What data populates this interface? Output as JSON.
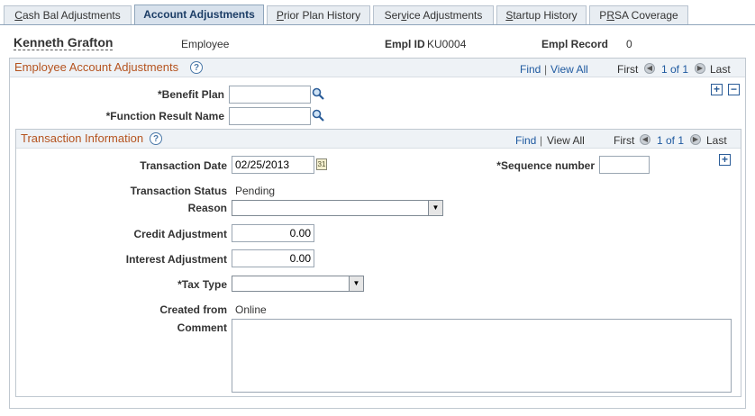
{
  "tabs": [
    {
      "prefix": "",
      "u": "C",
      "rest": "ash Bal Adjustments"
    },
    {
      "prefix": "",
      "u": "",
      "rest": "Account Adjustments"
    },
    {
      "prefix": "",
      "u": "P",
      "rest": "rior Plan History"
    },
    {
      "prefix": "Ser",
      "u": "v",
      "rest": "ice Adjustments"
    },
    {
      "prefix": "",
      "u": "S",
      "rest": "tartup History"
    },
    {
      "prefix": "P",
      "u": "R",
      "rest": "SA Coverage"
    }
  ],
  "header": {
    "name": "Kenneth Grafton",
    "role": "Employee",
    "empl_id_label": "Empl ID",
    "empl_id": "KU0004",
    "empl_record_label": "Empl Record",
    "empl_record": "0"
  },
  "account_box": {
    "title": "Employee Account Adjustments",
    "find": "Find",
    "view_all": "View All",
    "first": "First",
    "count": "1 of 1",
    "last": "Last",
    "benefit_plan_label": "*Benefit Plan",
    "benefit_plan_value": "",
    "function_result_label": "*Function Result Name",
    "function_result_value": ""
  },
  "transaction_box": {
    "title": "Transaction Information",
    "find": "Find",
    "view_all": "View All",
    "first": "First",
    "count": "1 of 1",
    "last": "Last",
    "date_label": "Transaction Date",
    "date_value": "02/25/2013",
    "sequence_label": "*Sequence number",
    "sequence_value": "",
    "status_label": "Transaction Status",
    "status_value": "Pending",
    "reason_label": "Reason",
    "reason_value": "",
    "credit_label": "Credit Adjustment",
    "credit_value": "0.00",
    "interest_label": "Interest Adjustment",
    "interest_value": "0.00",
    "tax_label": "*Tax Type",
    "tax_value": "",
    "created_label": "Created from",
    "created_value": "Online",
    "comment_label": "Comment",
    "comment_value": ""
  },
  "icons": {
    "help": "help-icon",
    "lookup": "magnifier-icon",
    "calendar": "calendar-icon",
    "prev": "left-arrow-icon",
    "next": "right-arrow-icon",
    "add": "plus-icon",
    "delete": "minus-icon"
  }
}
